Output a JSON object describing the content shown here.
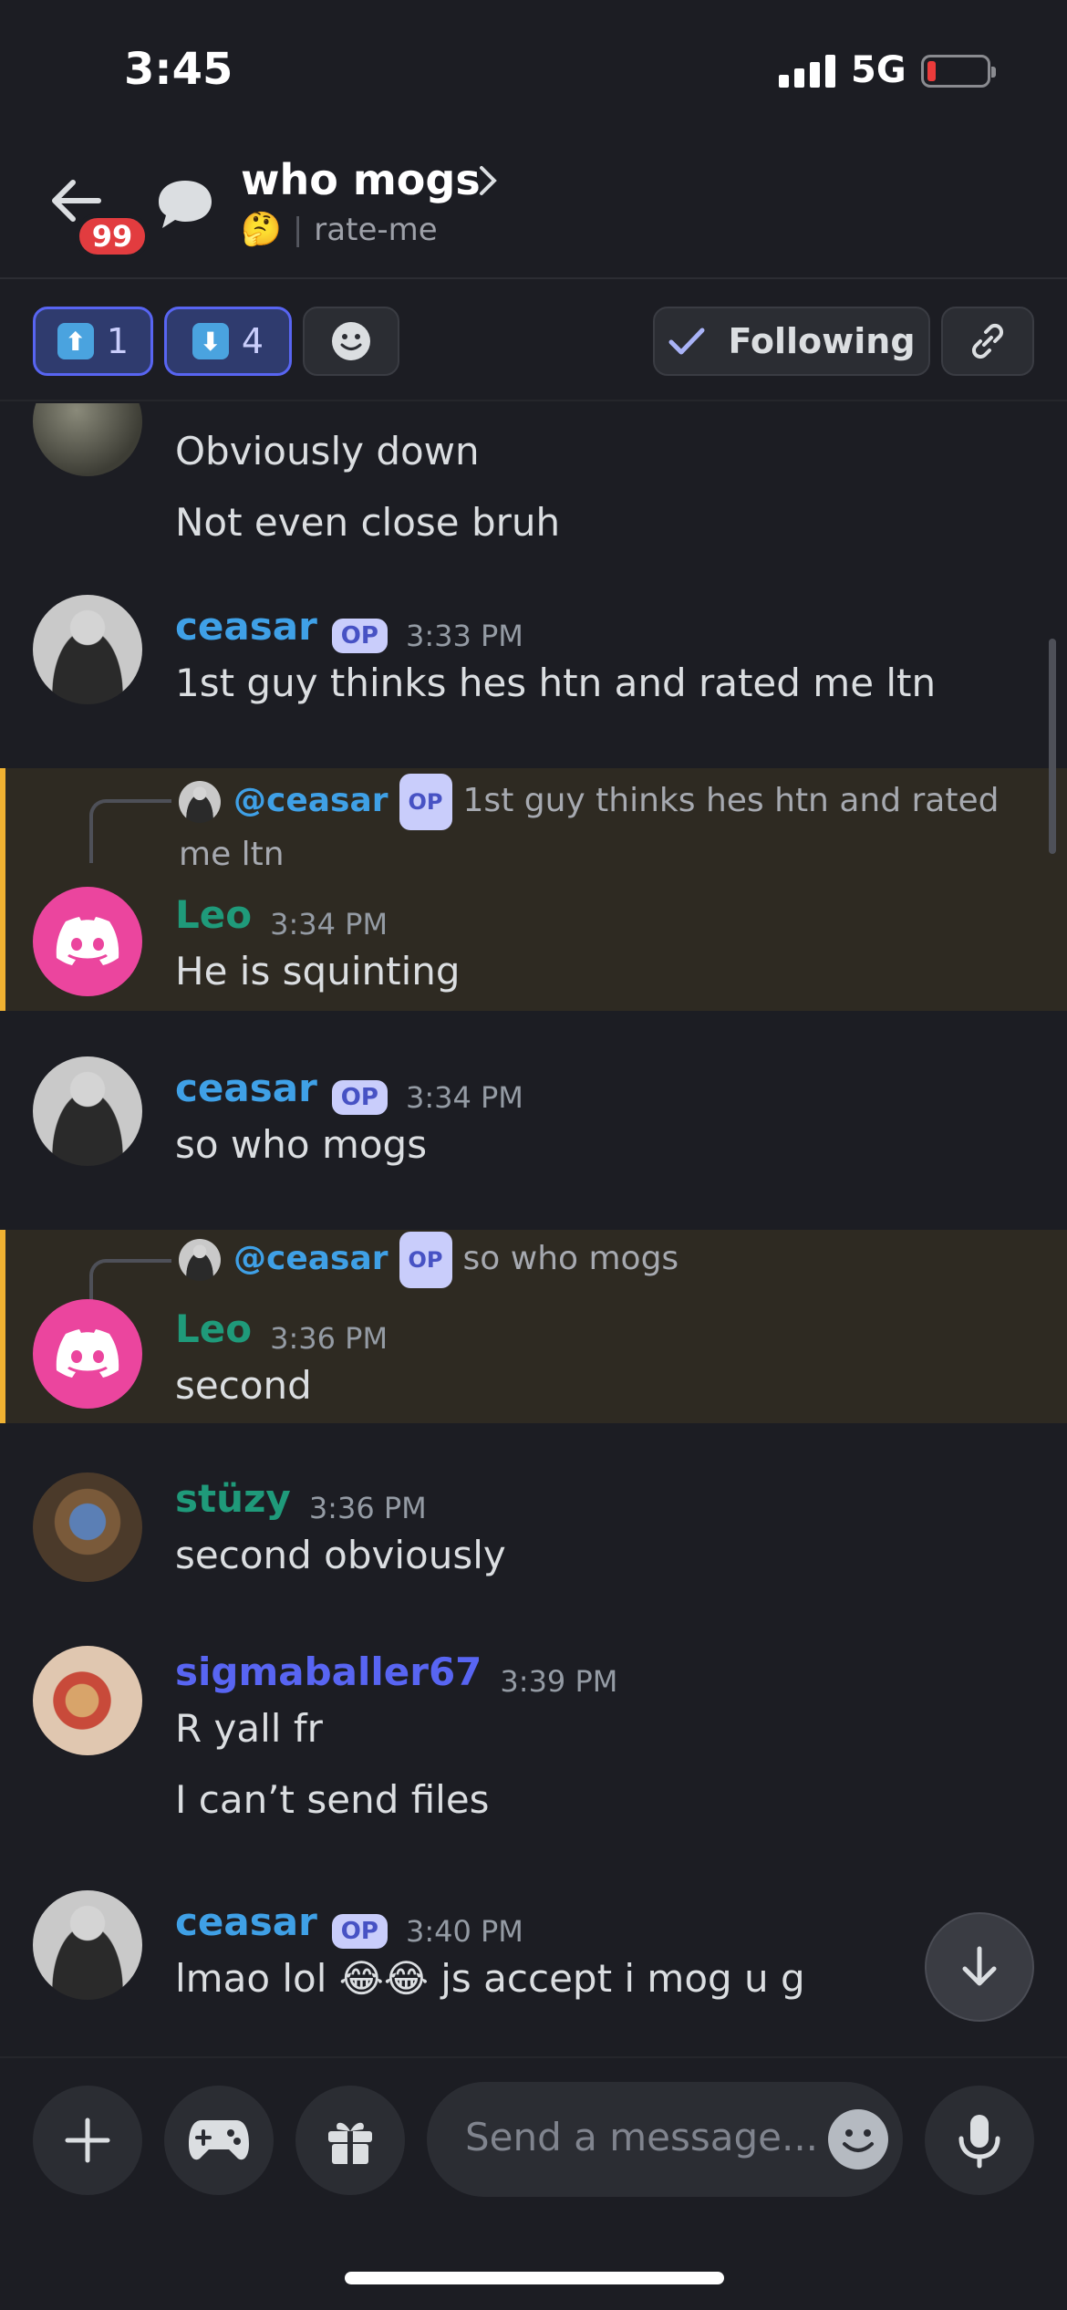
{
  "status_bar": {
    "time": "3:45",
    "network": "5G"
  },
  "header": {
    "back_badge": "99",
    "title": "who mogs",
    "emoji": "🤔",
    "channel": "rate-me"
  },
  "reactions": {
    "upvote_count": "1",
    "downvote_count": "4",
    "following_label": "Following"
  },
  "messages": [
    {
      "lines": [
        "Obviously down",
        "Not even close bruh"
      ]
    },
    {
      "author": "ceasar",
      "op": "OP",
      "time": "3:33 PM",
      "lines": [
        "1st guy thinks hes htn and rated me ltn"
      ]
    },
    {
      "reply_mention": "@ceasar",
      "reply_op": "OP",
      "reply_text": "1st guy thinks hes htn and rated me ltn",
      "author": "Leo",
      "time": "3:34 PM",
      "lines": [
        "He is squinting"
      ]
    },
    {
      "author": "ceasar",
      "op": "OP",
      "time": "3:34 PM",
      "lines": [
        "so who mogs"
      ]
    },
    {
      "reply_mention": "@ceasar",
      "reply_op": "OP",
      "reply_text": "so who mogs",
      "author": "Leo",
      "time": "3:36 PM",
      "lines": [
        "second"
      ]
    },
    {
      "author": "stüzy",
      "time": "3:36 PM",
      "lines": [
        "second obviously"
      ]
    },
    {
      "author": "sigmaballer67",
      "time": "3:39 PM",
      "lines": [
        "R yall fr",
        "I can’t send files"
      ]
    },
    {
      "author": "ceasar",
      "op": "OP",
      "time": "3:40 PM",
      "lines": [
        "lmao lol 😂😂 js accept i mog u g"
      ]
    }
  ],
  "composer": {
    "placeholder": "Send a message..."
  },
  "colors": {
    "accent": "#5865f2",
    "highlight_bar": "#f0b232",
    "discord_pink": "#eb459e"
  }
}
